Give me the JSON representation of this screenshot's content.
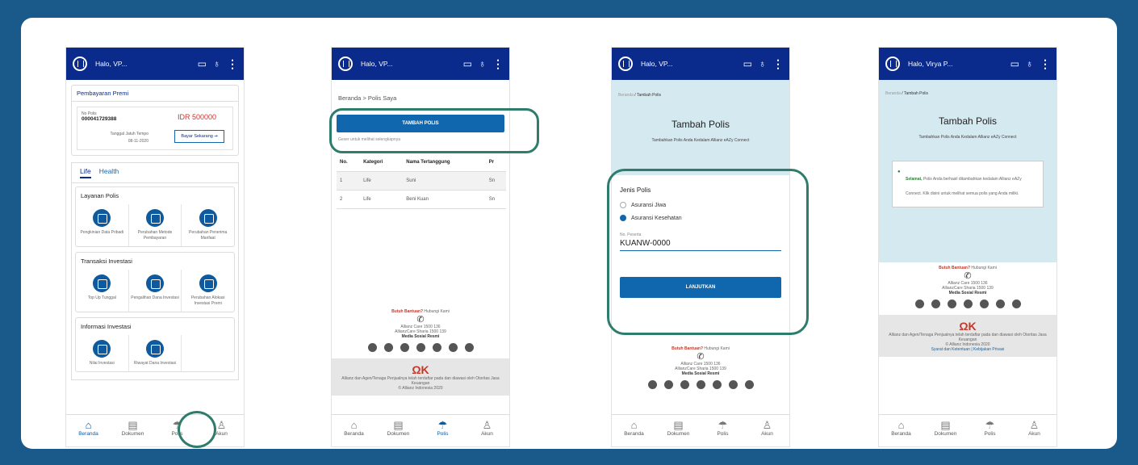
{
  "phone1": {
    "greeting": "Halo, VP...",
    "premium": {
      "title": "Pembayaran Premi",
      "policy_label": "No Polis",
      "policy_no": "000041729388",
      "amount": "IDR 500000",
      "due_label": "Tanggal Jatuh Tempo",
      "due_date": "08-11-2020",
      "pay_button": "Bayar Sekarang ➞"
    },
    "tabs": [
      "Life",
      "Health"
    ],
    "sections": [
      {
        "title": "Layanan Polis",
        "items": [
          "Pengkinian Data Pribadi",
          "Perubahan Metode Pembayaran",
          "Perubahan Penerima Manfaat"
        ]
      },
      {
        "title": "Transaksi Investasi",
        "items": [
          "Top Up Tunggal",
          "Pengalihan Dana Investasi",
          "Perubahan Alokasi Investasi Premi"
        ]
      },
      {
        "title": "Informasi Investasi",
        "items": [
          "Nilai Investasi",
          "Riwayat Dana Investasi"
        ]
      }
    ]
  },
  "phone2": {
    "greeting": "Halo, VP...",
    "breadcrumb": "Beranda > Polis Saya",
    "add_button": "TAMBAH POLIS",
    "hint": "Geser untuk melihat selengkapnya",
    "table": {
      "headers": [
        "No.",
        "Kategori",
        "Nama Tertanggung",
        "Pr"
      ],
      "rows": [
        [
          "1",
          "Life",
          "Suni",
          "Sn"
        ],
        [
          "2",
          "Life",
          "Beni Kuan",
          "Sn"
        ]
      ]
    }
  },
  "phone3": {
    "greeting": "Halo, VP...",
    "breadcrumb_home": "Beranda",
    "breadcrumb_current": "/ Tambah Polis",
    "title": "Tambah Polis",
    "subtitle": "Tambahkan Polis Anda Kedalam Allianz eAZy Connect",
    "type_label": "Jenis Polis",
    "options": [
      "Asuransi Jiwa",
      "Asuransi Kesehatan"
    ],
    "member_label": "No. Peserta",
    "member_value": "KUANW-0000",
    "continue_button": "LANJUTKAN"
  },
  "phone4": {
    "greeting": "Halo, Virya P...",
    "breadcrumb_home": "Beranda",
    "breadcrumb_current": "/ Tambah Polis",
    "title": "Tambah Polis",
    "subtitle": "Tambahkan Polis Anda Kedalam Allianz eAZy Connect",
    "success_bold": "Selamat,",
    "success_text": "Polis Anda berhasil ditambahkan kedalam Allianz eAZy Connect. Klik disini untuk melihat semua polis yang Anda miliki."
  },
  "footer": {
    "help_bold": "Butuh Bantuan?",
    "help_text": " Hubungi Kami",
    "allianz_care": "Allianz Care 1500 136",
    "allianz_syariah": "AllianzCare Sharia 1500 139",
    "social_title": "Media Sosial Resmi",
    "ojk_text": "Allianz dan Agen/Tenaga Penjualnya telah terdaftar pada dan diawasi oleh Otoritas Jasa Keuangan",
    "copyright": "© Allianz Indonesia 2020",
    "links": "Syarat dan Ketentuan | Kebijakan Privasi"
  },
  "nav": [
    "Beranda",
    "Dokumen",
    "Polis",
    "Akun"
  ],
  "colors": {
    "header": "#0a2a8c",
    "button": "#1167ad",
    "highlight": "#2e7d6c",
    "frame": "#1a5a8a"
  }
}
